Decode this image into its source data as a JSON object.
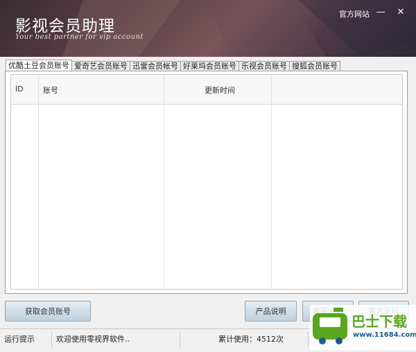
{
  "window": {
    "title": "影视会员助理",
    "subtitle": "Your best partner for vip  account",
    "official_link": "官方网站",
    "minimize_glyph": "—",
    "close_glyph": "✕"
  },
  "tabs": [
    {
      "label": "优酷土豆会员账号",
      "active": true
    },
    {
      "label": "爱奇艺会员账号"
    },
    {
      "label": "迅雷会员帐号"
    },
    {
      "label": "好莱坞会员账号"
    },
    {
      "label": "乐视会员账号"
    },
    {
      "label": "搜狐会员账号"
    }
  ],
  "table": {
    "columns": [
      "ID",
      "账号",
      "更新时间",
      ""
    ],
    "rows": []
  },
  "buttons": {
    "get_account": "获取会员账号",
    "product_info": "产品说明",
    "customer_service": "客服中心",
    "forum": "官方论坛"
  },
  "status": {
    "label": "运行提示",
    "message": "欢迎使用零视界软件..",
    "usage": "累计使用：4512次"
  },
  "watermark": {
    "brand": "巴士下载",
    "url": "www.11684.com",
    "colors": {
      "green": "#5aa61e",
      "dark": "#1e5a8c"
    }
  }
}
